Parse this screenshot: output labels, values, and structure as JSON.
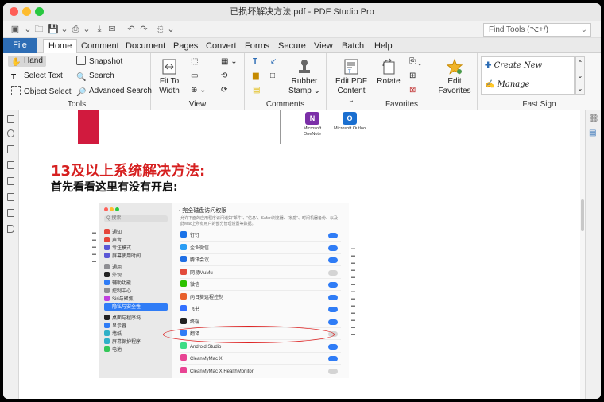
{
  "window": {
    "title": "已损坏解决方法.pdf - PDF Studio Pro",
    "find_tools_placeholder": "Find Tools (⌥+/)"
  },
  "menu_tabs": [
    "File",
    "Home",
    "Comment",
    "Document",
    "Pages",
    "Convert",
    "Forms",
    "Secure",
    "View",
    "Batch",
    "Help"
  ],
  "ribbon": {
    "tools": {
      "hand": "Hand",
      "select_text": "Select Text",
      "object_select": "Object Select",
      "snapshot": "Snapshot",
      "search": "Search",
      "advanced_search": "Advanced Search",
      "label": "Tools"
    },
    "view": {
      "fit_to_width_1": "Fit To",
      "fit_to_width_2": "Width",
      "label": "View"
    },
    "comments": {
      "rubber_stamp_1": "Rubber",
      "rubber_stamp_2": "Stamp ⌄",
      "label": "Comments"
    },
    "favorites": {
      "edit_pdf_1": "Edit PDF",
      "edit_pdf_2": "Content ⌄",
      "rotate": "Rotate",
      "edit_favorites_1": "Edit",
      "edit_favorites_2": "Favorites",
      "label": "Favorites"
    },
    "fast_sign": {
      "create_new": "Create New",
      "manage": "Manage",
      "label": "Fast Sign"
    }
  },
  "document": {
    "heading": "13及以上系统解决方法:",
    "subheading": "首先看看这里有没有开启:",
    "app_labels": [
      {
        "name": "Microsoft OneNote",
        "line1": "Microsoft",
        "line2": "OneNote"
      },
      {
        "name": "Microsoft Outlook",
        "line1": "Microsoft Outloo",
        "line2": ""
      }
    ],
    "screenshot": {
      "header": "完全磁盘访问权限",
      "search_placeholder": "Q 搜索",
      "description": "允许下面的应用程序访问诸如“邮件”、“信息”、Safari浏览器、“家庭”、时间机器备份、以及此Mac上所有用户的部分管理设置等数据。",
      "sidebar_items": [
        "通知",
        "声音",
        "专注模式",
        "屏幕使用时间",
        "通用",
        "外观",
        "辅助功能",
        "控制中心",
        "Siri与聚焦",
        "隐私与安全性",
        "桌面与程序坞",
        "显示器",
        "墙纸",
        "屏幕保护程序",
        "电池"
      ],
      "apps": [
        {
          "name": "钉钉",
          "on": true
        },
        {
          "name": "企业微信",
          "on": true
        },
        {
          "name": "腾讯会议",
          "on": true
        },
        {
          "name": "网易MuMu",
          "on": false
        },
        {
          "name": "微信",
          "on": true
        },
        {
          "name": "向日葵远程控制",
          "on": true
        },
        {
          "name": "飞书",
          "on": true
        },
        {
          "name": "终端",
          "on": true
        },
        {
          "name": "翻译",
          "on": false
        },
        {
          "name": "Android Studio",
          "on": true
        },
        {
          "name": "CleanMyMac X",
          "on": true
        },
        {
          "name": "CleanMyMac X HealthMonitor",
          "on": false
        }
      ]
    }
  },
  "colors": {
    "accent": "#2d6db5",
    "heading_red": "#d62020",
    "toggle_on": "#2f7cf6",
    "toggle_off": "#d4d4d4",
    "highlight_ellipse": "#dd2222"
  }
}
